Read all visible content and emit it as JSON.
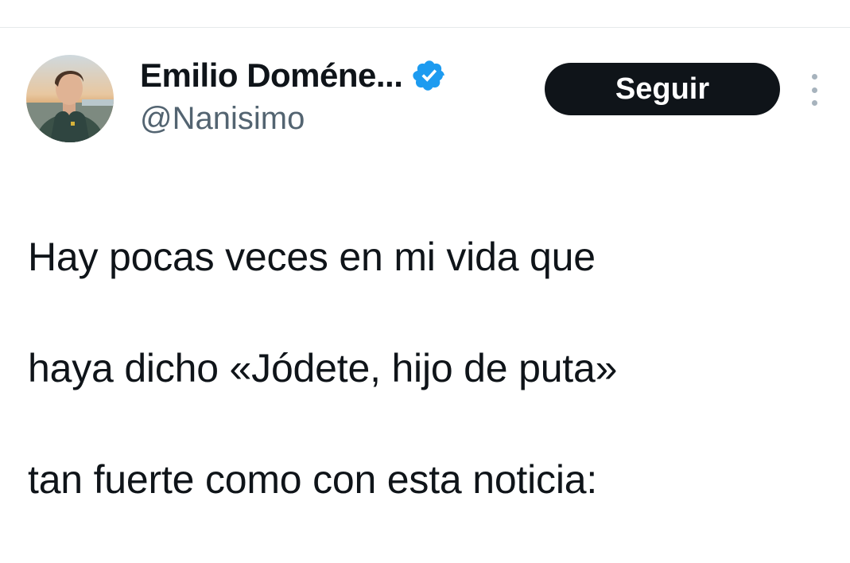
{
  "tweet": {
    "author": {
      "display_name": "Emilio Doméne...",
      "handle": "@Nanisimo",
      "verified": true,
      "avatar_icon": "profile-photo",
      "verified_icon": "verified-badge-icon",
      "verified_color": "#1d9bf0"
    },
    "follow_label": "Seguir",
    "more_icon": "more-options-icon",
    "text_lines": [
      "Hay pocas veces en mi vida que",
      "haya dicho «Jódete, hijo de puta»",
      "tan fuerte como con esta noticia:"
    ]
  },
  "colors": {
    "text_primary": "#0f1419",
    "text_secondary": "#536471",
    "button_bg": "#0f1419",
    "button_text": "#ffffff",
    "divider": "#e6e9eb"
  }
}
